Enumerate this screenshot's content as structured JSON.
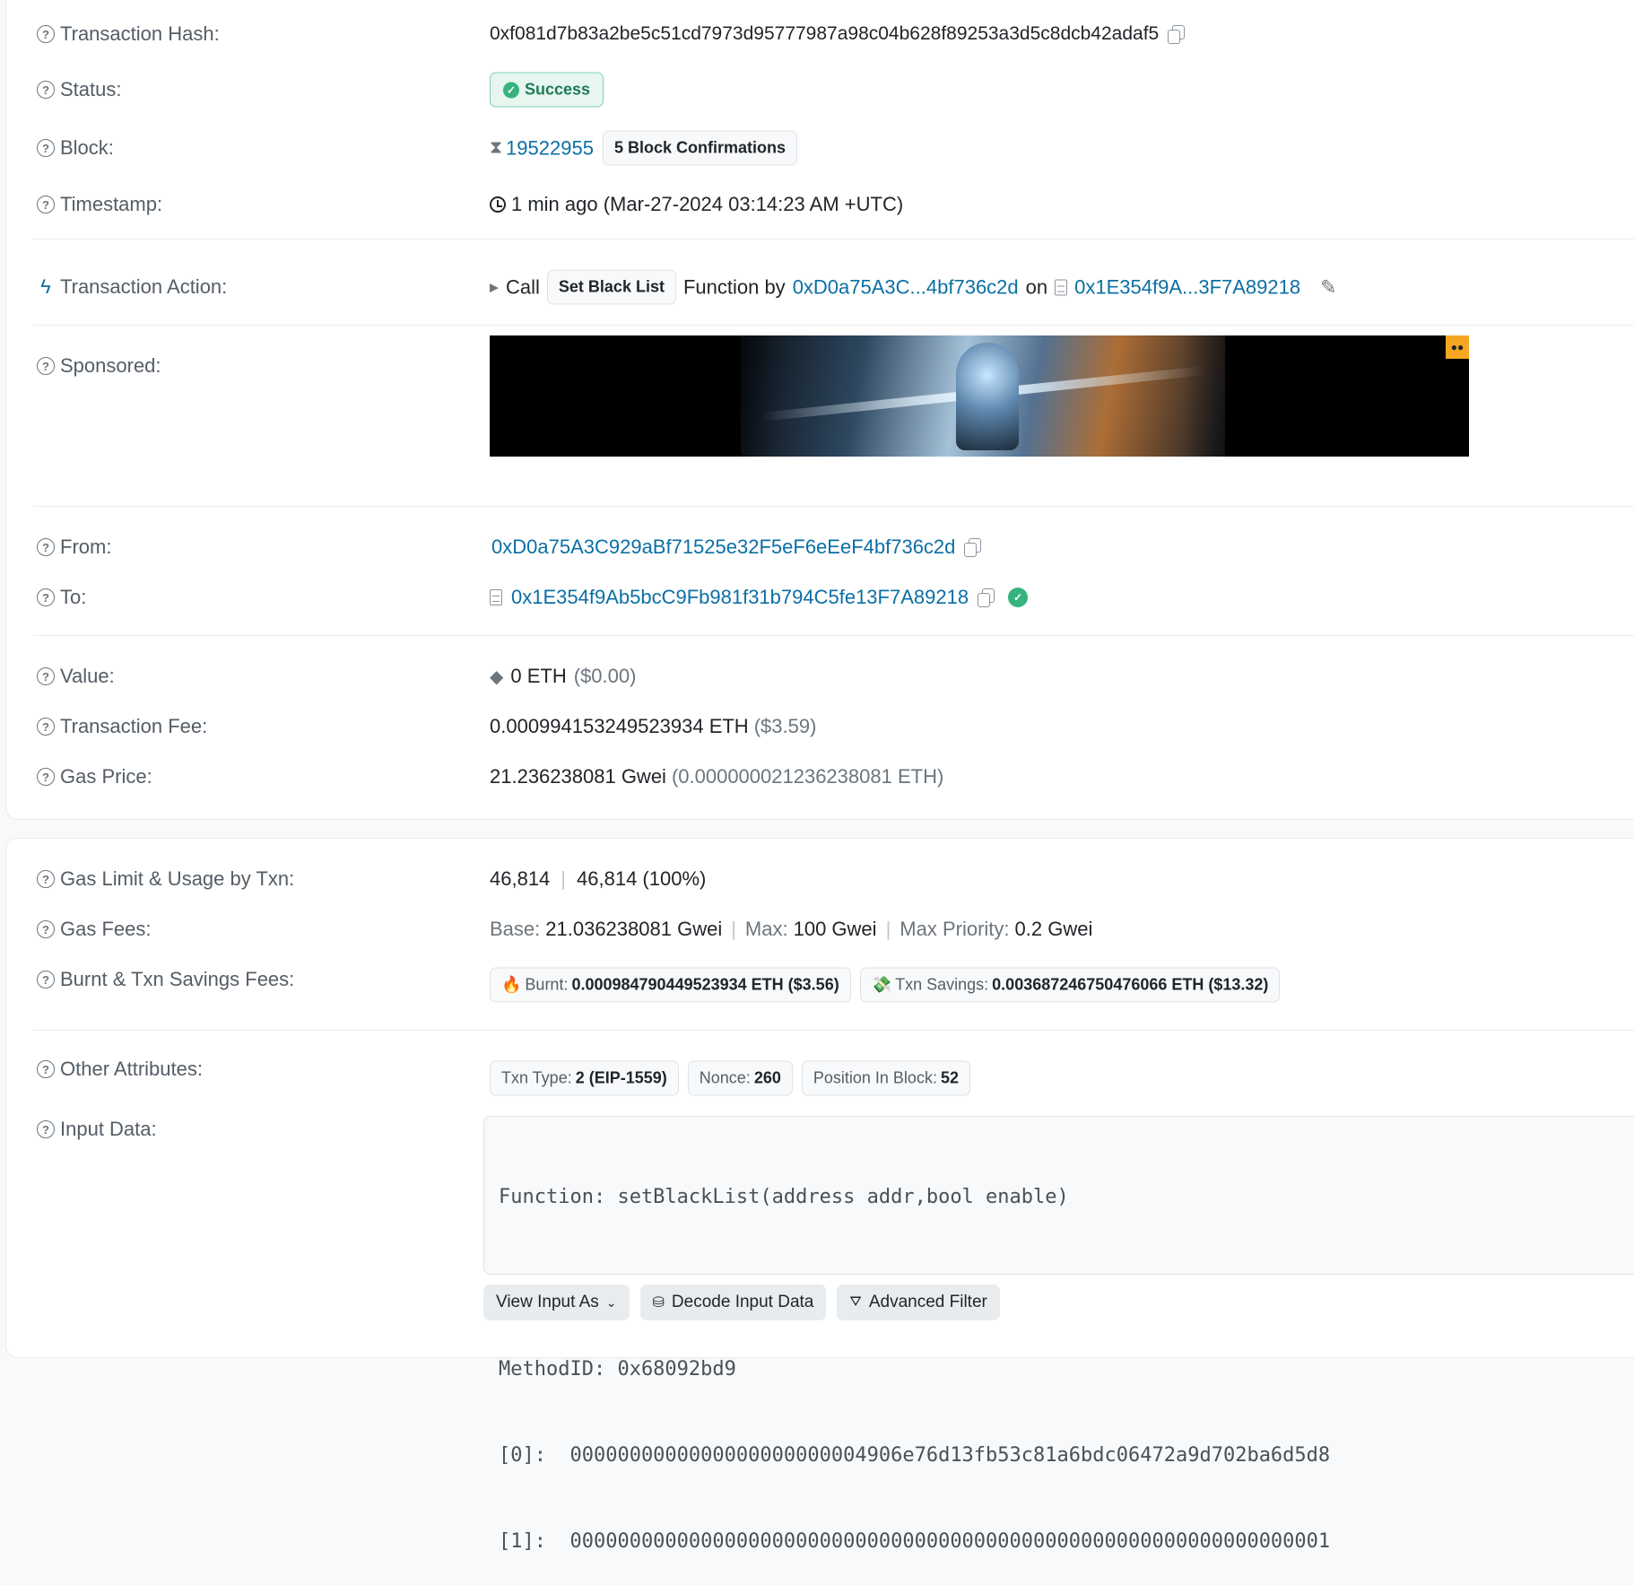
{
  "overview": {
    "tx_hash_label": "Transaction Hash:",
    "tx_hash": "0xf081d7b83a2be5c51cd7973d95777987a98c04b628f89253a3d5c8dcb42adaf5",
    "status_label": "Status:",
    "status": "Success",
    "block_label": "Block:",
    "block": "19522955",
    "block_confirmations": "5 Block Confirmations",
    "timestamp_label": "Timestamp:",
    "timestamp": "1 min ago (Mar-27-2024 03:14:23 AM +UTC)"
  },
  "action": {
    "label": "Transaction Action:",
    "call": "Call",
    "method": "Set Black List",
    "function_by": "Function by",
    "caller": "0xD0a75A3C...4bf736c2d",
    "on": "on",
    "contract": "0x1E354f9A...3F7A89218"
  },
  "sponsored": {
    "label": "Sponsored:"
  },
  "parties": {
    "from_label": "From:",
    "from": "0xD0a75A3C929aBf71525e32F5eF6eEeF4bf736c2d",
    "to_label": "To:",
    "to": "0x1E354f9Ab5bcC9Fb981f31b794C5fe13F7A89218"
  },
  "fees": {
    "value_label": "Value:",
    "value": "0 ETH",
    "value_usd": "($0.00)",
    "tx_fee_label": "Transaction Fee:",
    "tx_fee": "0.000994153249523934 ETH",
    "tx_fee_usd": "($3.59)",
    "gas_price_label": "Gas Price:",
    "gas_price": "21.236238081 Gwei",
    "gas_price_eth": "(0.000000021236238081 ETH)"
  },
  "gas": {
    "limit_label": "Gas Limit & Usage by Txn:",
    "limit": "46,814",
    "usage": "46,814 (100%)",
    "fees_label": "Gas Fees:",
    "base_key": "Base:",
    "base": "21.036238081 Gwei",
    "max_key": "Max:",
    "max": "100 Gwei",
    "priority_key": "Max Priority:",
    "priority": "0.2 Gwei",
    "burnt_label": "Burnt & Txn Savings Fees:",
    "burnt_key": "Burnt:",
    "burnt": "0.000984790449523934 ETH ($3.56)",
    "savings_key": "Txn Savings:",
    "savings": "0.003687246750476066 ETH ($13.32)"
  },
  "attributes": {
    "label": "Other Attributes:",
    "txn_type_key": "Txn Type:",
    "txn_type": "2 (EIP-1559)",
    "nonce_key": "Nonce:",
    "nonce": "260",
    "position_key": "Position In Block:",
    "position": "52"
  },
  "input": {
    "label": "Input Data:",
    "lines": [
      "Function: setBlackList(address addr,bool enable)",
      "",
      "MethodID: 0x68092bd9",
      "[0]:  0000000000000000000000004906e76d13fb53c81a6bdc06472a9d702ba6d5d8",
      "[1]:  0000000000000000000000000000000000000000000000000000000000000001"
    ],
    "view_as": "View Input As",
    "decode": "Decode Input Data",
    "advanced": "Advanced Filter"
  },
  "colors": {
    "link": "#0b6fa5",
    "success": "#36b37e",
    "muted": "#6c757d"
  },
  "icons": [
    "question-circle-icon",
    "copy-icon",
    "check-circle-icon",
    "hourglass-icon",
    "clock-icon",
    "lightning-icon",
    "document-icon",
    "pencil-icon",
    "eth-icon",
    "fire-icon",
    "money-icon",
    "chevron-down-icon",
    "cubes-icon",
    "filter-icon"
  ]
}
